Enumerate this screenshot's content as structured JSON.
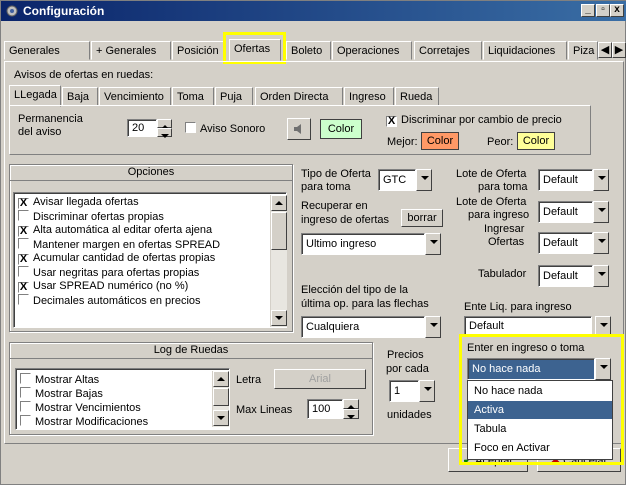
{
  "window": {
    "title": "Configuración",
    "controls": [
      "_",
      "x"
    ]
  },
  "tabs": {
    "items": [
      "Generales",
      "+ Generales",
      "Posición",
      "Ofertas",
      "Boleto",
      "Operaciones",
      "Corretajes",
      "Liquidaciones",
      "Piza"
    ],
    "active": "Ofertas"
  },
  "avisos": {
    "label": "Avisos de ofertas en ruedas:",
    "subtabs": [
      "LLegada",
      "Baja",
      "Vencimiento",
      "Toma",
      "Puja",
      "Orden Directa",
      "Ingreso",
      "Rueda"
    ],
    "permanencia_label_1": "Permanencia",
    "permanencia_label_2": "del aviso",
    "permanencia_value": "20",
    "aviso_sonoro_label": "Aviso Sonoro",
    "color_button": "Color",
    "discriminar_label": "Discriminar por cambio de precio",
    "mejor_label": "Mejor:",
    "peor_label": "Peor:",
    "mejor_color_button": "Color",
    "peor_color_button": "Color",
    "colors": {
      "mejor": "#ff9966",
      "peor": "#ffff99",
      "color_btn": "#ccffcc"
    }
  },
  "opciones": {
    "title": "Opciones",
    "items": [
      {
        "label": "Avisar llegada ofertas",
        "checked": "X"
      },
      {
        "label": "Discriminar ofertas propias",
        "checked": ""
      },
      {
        "label": "Alta automática al editar oferta ajena",
        "checked": "X"
      },
      {
        "label": "Mantener margen en ofertas SPREAD",
        "checked": ""
      },
      {
        "label": "Acumular cantidad de ofertas propias",
        "checked": "X"
      },
      {
        "label": "Usar negritas para ofertas propias",
        "checked": ""
      },
      {
        "label": "Usar SPREAD numérico (no %)",
        "checked": "X"
      },
      {
        "label": "Decimales automáticos en precios",
        "checked": ""
      }
    ]
  },
  "middle": {
    "tipo_oferta_label_1": "Tipo de Oferta",
    "tipo_oferta_label_2": "para toma",
    "tipo_oferta_value": "GTC",
    "recuperar_label_1": "Recuperar en",
    "recuperar_label_2": "ingreso de ofertas",
    "borrar_button": "borrar",
    "ultimo_ingreso_value": "Ultimo ingreso",
    "eleccion_label_1": "Elección del tipo de la",
    "eleccion_label_2": "última op. para las flechas",
    "eleccion_value": "Cualquiera",
    "precios_label_1": "Precios",
    "precios_label_2": "por cada",
    "precios_value": "1",
    "unidades_label": "unidades"
  },
  "right": {
    "lote_toma_label_1": "Lote de Oferta",
    "lote_toma_label_2": "para toma",
    "lote_toma_value": "Default",
    "lote_ingreso_label_1": "Lote de Oferta",
    "lote_ingreso_label_2": "para ingreso",
    "lote_ingreso_value": "Default",
    "ingresar_label_1": "Ingresar",
    "ingresar_label_2": "Ofertas",
    "ingresar_value": "Default",
    "tabulador_label": "Tabulador",
    "tabulador_value": "Default",
    "ente_label": "Ente Liq. para ingreso",
    "ente_value": "Default",
    "enter_label": "Enter en ingreso o toma",
    "enter_value": "No hace nada",
    "dropdown_options": [
      "No hace nada",
      "Activa",
      "Tabula",
      "Foco en Activar"
    ],
    "dropdown_selected": "Activa"
  },
  "log": {
    "title": "Log de Ruedas",
    "items": [
      "Mostrar Altas",
      "Mostrar Bajas",
      "Mostrar Vencimientos",
      "Mostrar Modificaciones"
    ],
    "letra_label": "Letra",
    "letra_value": "Arial",
    "max_lineas_label": "Max Lineas",
    "max_lineas_value": "100"
  },
  "footer": {
    "aceptar_button": "Aceptar",
    "cancelar_button": "Cancelar"
  },
  "highlight_color": "#ffff00"
}
